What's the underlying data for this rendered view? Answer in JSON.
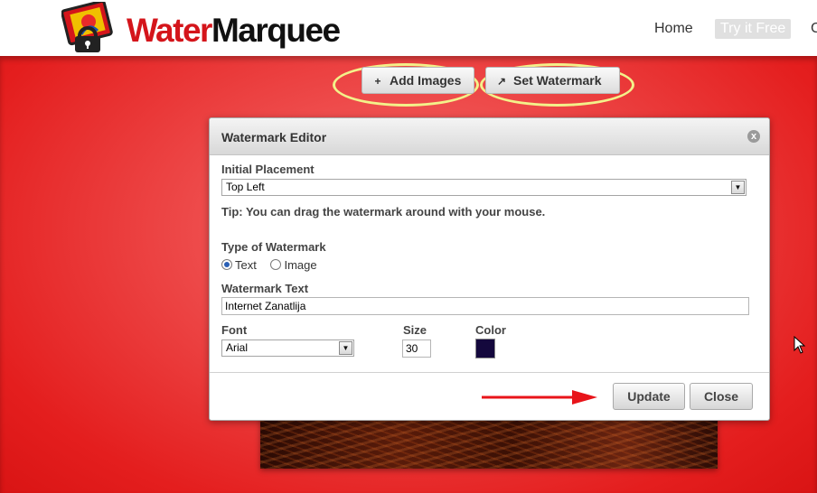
{
  "header": {
    "logo_text_brand": "Water",
    "logo_text_rest": "Marquee",
    "nav": {
      "home": "Home",
      "try_free": "Try it Free",
      "cut_off": "C"
    }
  },
  "toolbar": {
    "add_images_icon": "+",
    "add_images_label": "Add Images",
    "set_watermark_icon": "↗",
    "set_watermark_label": "Set Watermark"
  },
  "dialog": {
    "title": "Watermark Editor",
    "close_icon": "x",
    "placement": {
      "label": "Initial Placement",
      "value": "Top Left"
    },
    "tip": "Tip: You can drag the watermark around with your mouse.",
    "type": {
      "label": "Type of Watermark",
      "options": [
        "Text",
        "Image"
      ],
      "selected": "Text"
    },
    "text": {
      "label": "Watermark Text",
      "value": "Internet Zanatlija"
    },
    "font": {
      "label": "Font",
      "value": "Arial"
    },
    "size": {
      "label": "Size",
      "value": "30"
    },
    "color": {
      "label": "Color",
      "value": "#14083d"
    },
    "buttons": {
      "update": "Update",
      "close": "Close"
    }
  },
  "colors": {
    "brand_red": "#d4151b",
    "background_red": "#e41e1e",
    "highlight_oval": "#f3f18a",
    "annotation_arrow": "#e8141a"
  }
}
